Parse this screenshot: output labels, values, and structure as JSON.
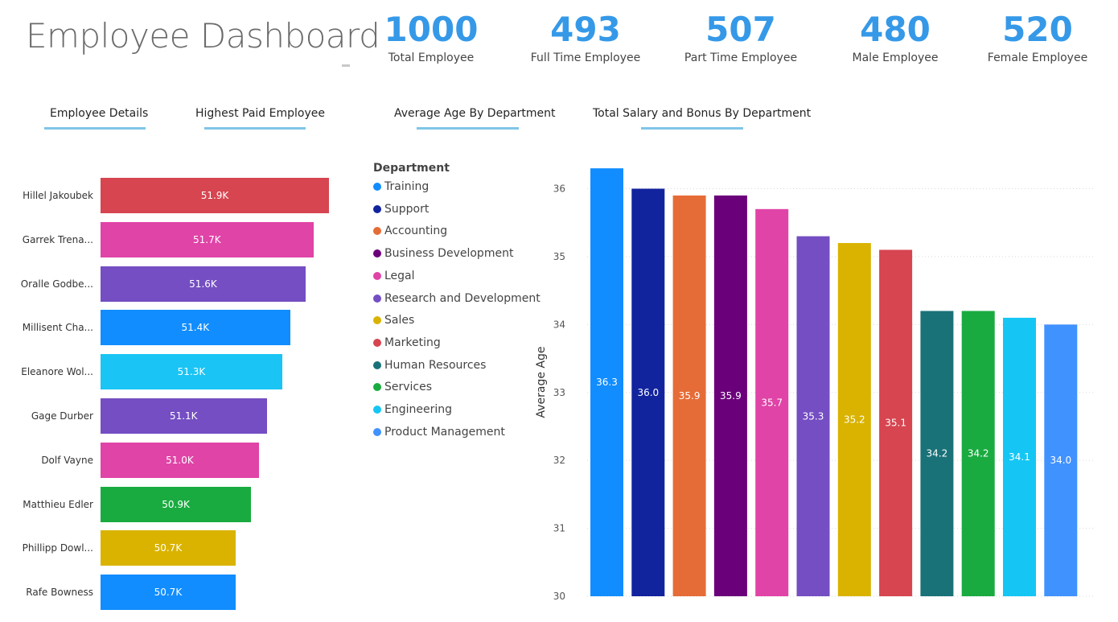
{
  "title": "Employee Dashboard",
  "kpis": [
    {
      "value": "1000",
      "label": "Total Employee"
    },
    {
      "value": "493",
      "label": "Full Time Employee"
    },
    {
      "value": "507",
      "label": "Part Time Employee"
    },
    {
      "value": "480",
      "label": "Male Employee"
    },
    {
      "value": "520",
      "label": "Female Employee"
    }
  ],
  "tabs": [
    {
      "label": "Employee Details"
    },
    {
      "label": "Highest Paid Employee"
    },
    {
      "label": "Average Age By Department"
    },
    {
      "label": "Total Salary and Bonus By Department"
    }
  ],
  "accent_color": "#3599e8",
  "top_paid": {
    "type": "bar",
    "orientation": "horizontal",
    "categories": [
      "Hillel Jakoubek",
      "Garrek Trena...",
      "Oralle Godbe...",
      "Millisent Cha...",
      "Eleanore Wol...",
      "Gage Durber",
      "Dolf Vayne",
      "Matthieu Edler",
      "Phillipp Dowl...",
      "Rafe Bowness"
    ],
    "values": [
      51.9,
      51.7,
      51.6,
      51.4,
      51.3,
      51.1,
      51.0,
      50.9,
      50.7,
      50.7
    ],
    "labels": [
      "51.9K",
      "51.7K",
      "51.6K",
      "51.4K",
      "51.3K",
      "51.1K",
      "51.0K",
      "50.9K",
      "50.7K",
      "50.7K"
    ],
    "colors": [
      "#d64550",
      "#e044a7",
      "#744ec2",
      "#118dff",
      "#1ac4f4",
      "#744ec2",
      "#e044a7",
      "#1aab40",
      "#d9b300",
      "#118dff"
    ]
  },
  "legend": {
    "title": "Department",
    "items": [
      {
        "label": "Training",
        "color": "#118dff"
      },
      {
        "label": "Support",
        "color": "#12239e"
      },
      {
        "label": "Accounting",
        "color": "#e66c37"
      },
      {
        "label": "Business Development",
        "color": "#6b007b"
      },
      {
        "label": "Legal",
        "color": "#e044a7"
      },
      {
        "label": "Research and Development",
        "color": "#744ec2"
      },
      {
        "label": "Sales",
        "color": "#d9b300"
      },
      {
        "label": "Marketing",
        "color": "#d64550"
      },
      {
        "label": "Human Resources",
        "color": "#197278"
      },
      {
        "label": "Services",
        "color": "#1aab40"
      },
      {
        "label": "Engineering",
        "color": "#15c6f4"
      },
      {
        "label": "Product Management",
        "color": "#4092ff"
      }
    ]
  },
  "chart_data": {
    "type": "bar",
    "ylabel": "Average Age",
    "ylim": [
      30,
      36.4
    ],
    "yticks": [
      30,
      31,
      32,
      33,
      34,
      35,
      36
    ],
    "grid": true,
    "legend_position": "left",
    "categories": [
      "Training",
      "Support",
      "Accounting",
      "Business Development",
      "Legal",
      "Research and Development",
      "Sales",
      "Marketing",
      "Human Resources",
      "Services",
      "Engineering",
      "Product Management"
    ],
    "values": [
      36.3,
      36.0,
      35.9,
      35.9,
      35.7,
      35.3,
      35.2,
      35.1,
      34.2,
      34.2,
      34.1,
      34.0
    ],
    "labels": [
      "36.3",
      "36.0",
      "35.9",
      "35.9",
      "35.7",
      "35.3",
      "35.2",
      "35.1",
      "34.2",
      "34.2",
      "34.1",
      "34.0"
    ],
    "colors": [
      "#118dff",
      "#12239e",
      "#e66c37",
      "#6b007b",
      "#e044a7",
      "#744ec2",
      "#d9b300",
      "#d64550",
      "#197278",
      "#1aab40",
      "#15c6f4",
      "#4092ff"
    ]
  }
}
